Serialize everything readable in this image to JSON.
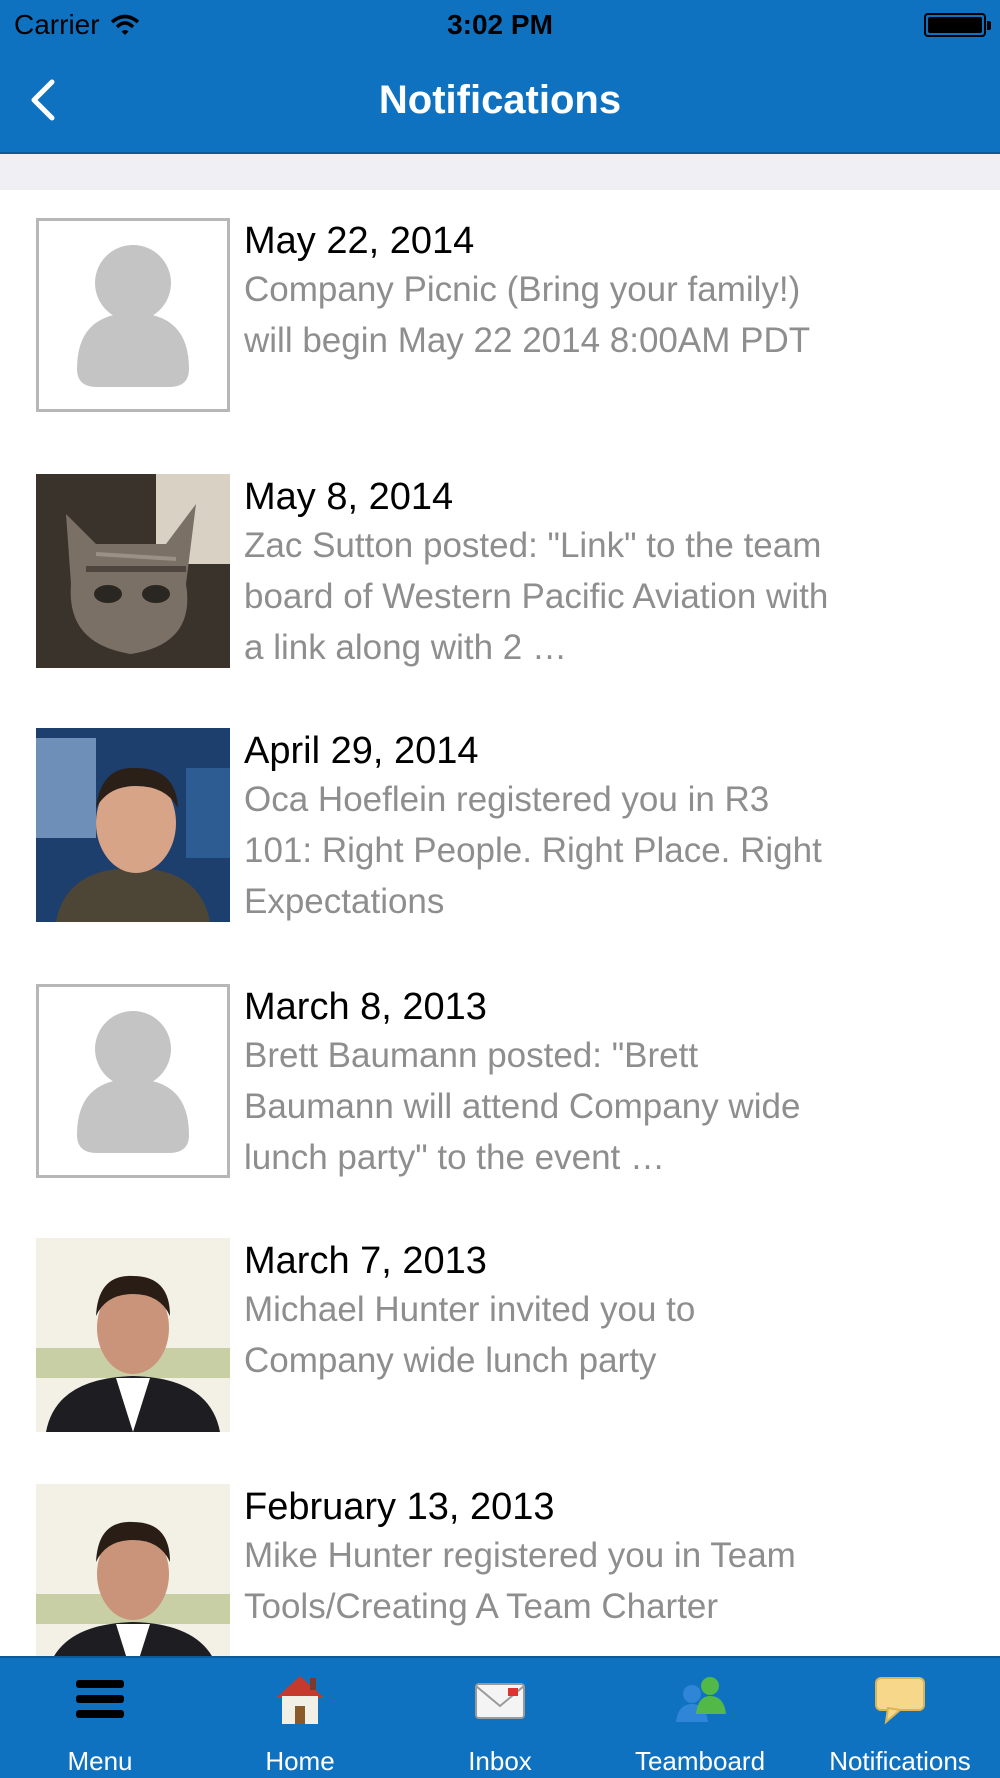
{
  "status_bar": {
    "carrier": "Carrier",
    "time": "3:02 PM"
  },
  "header": {
    "title": "Notifications"
  },
  "notifications": [
    {
      "date": "May 22, 2014",
      "text": "Company Picnic (Bring your family!) will begin May 22 2014 8:00AM PDT",
      "avatar": "placeholder"
    },
    {
      "date": "May 8, 2014",
      "text": "Zac Sutton posted: \"Link\" to the team board of Western Pacific Aviation with a link along with 2 …",
      "avatar": "cat-photo"
    },
    {
      "date": "April 29, 2014",
      "text": "Oca Hoeflein registered you in R3 101: Right People. Right Place. Right Expectations",
      "avatar": "man-photo"
    },
    {
      "date": "March 8, 2013",
      "text": "Brett Baumann posted: \"Brett Baumann will attend Company wide lunch party\" to the event …",
      "avatar": "placeholder"
    },
    {
      "date": "March 7, 2013",
      "text": "Michael Hunter invited you to Company wide lunch party",
      "avatar": "suit-man-photo"
    },
    {
      "date": "February 13, 2013",
      "text": "Mike Hunter registered you in Team Tools/Creating A Team Charter",
      "avatar": "suit-man-photo"
    }
  ],
  "tabs": [
    {
      "label": "Menu",
      "icon": "menu-icon"
    },
    {
      "label": "Home",
      "icon": "home-icon"
    },
    {
      "label": "Inbox",
      "icon": "envelope-icon"
    },
    {
      "label": "Teamboard",
      "icon": "people-icon"
    },
    {
      "label": "Notifications",
      "icon": "speech-bubble-icon"
    }
  ],
  "colors": {
    "bar": "#0f72c1",
    "date_text": "#000000",
    "desc_text": "#8e8e8e",
    "strip": "#efeff4"
  }
}
